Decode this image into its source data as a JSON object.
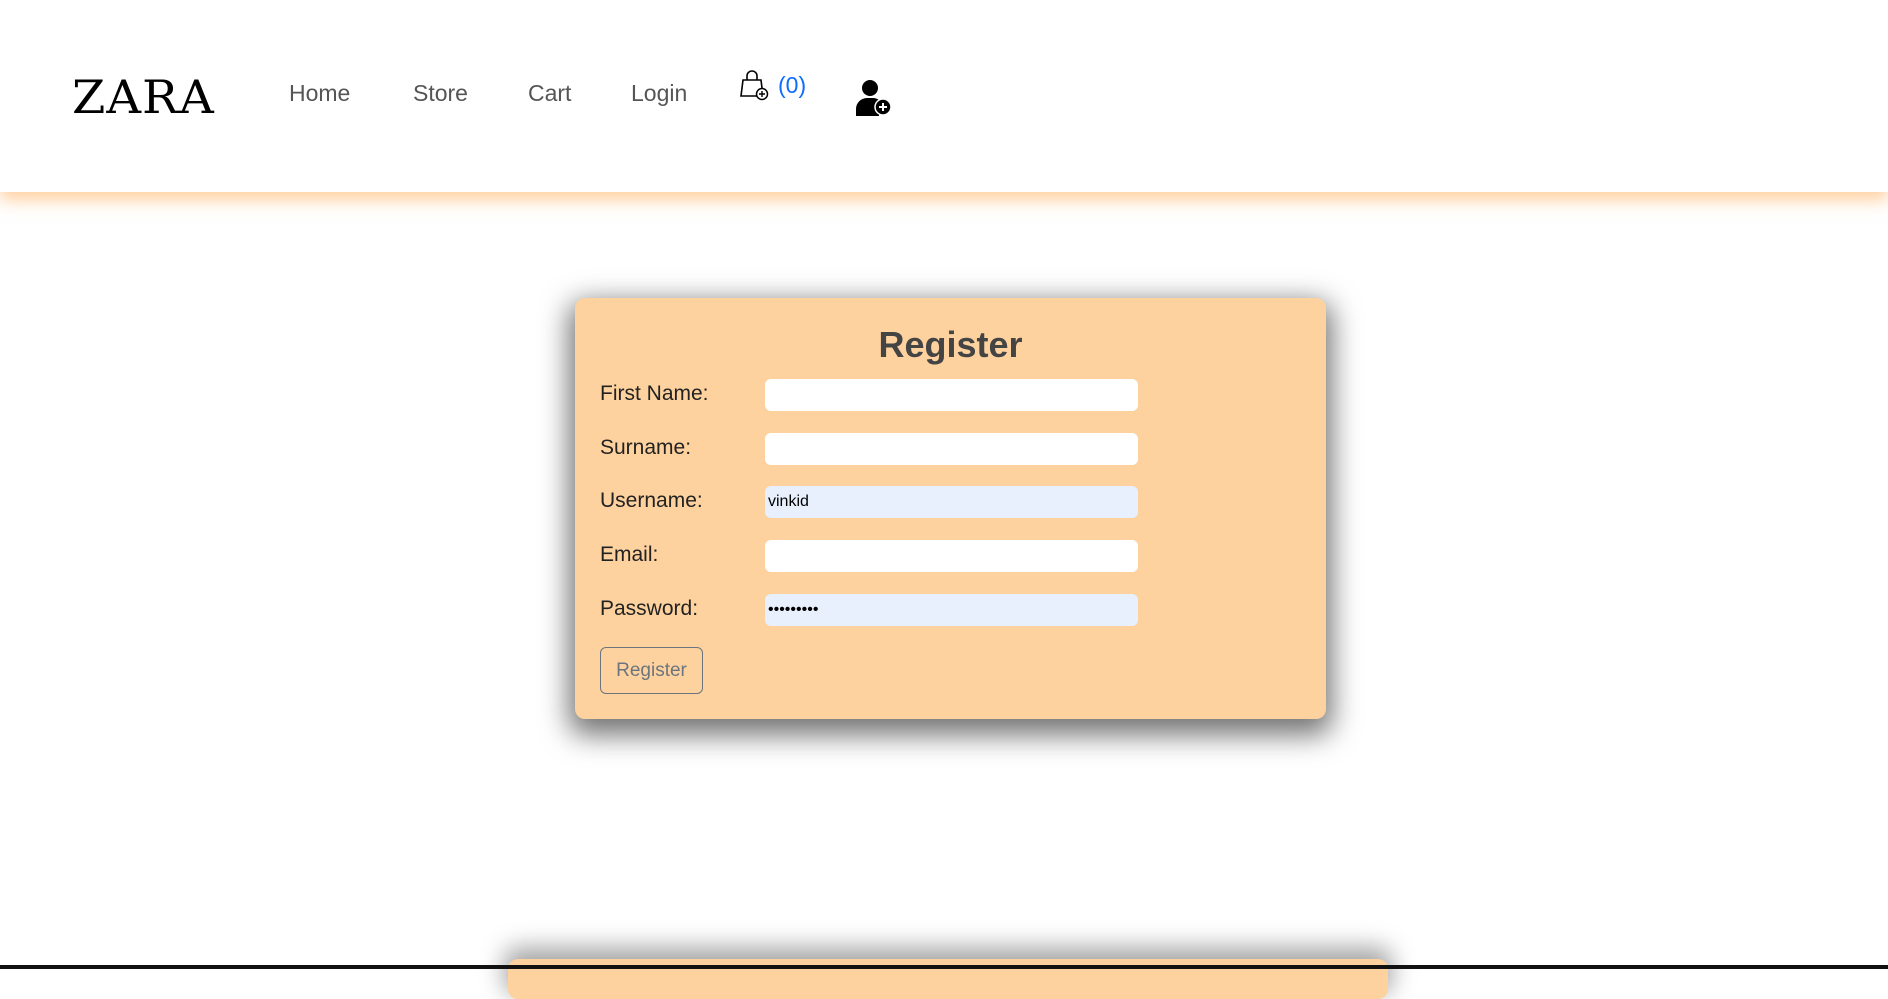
{
  "header": {
    "logo": "ZARA",
    "nav": [
      "Home",
      "Store",
      "Cart",
      "Login"
    ],
    "cart_count": "(0)",
    "cart_icon": "shopping-bag-plus-icon",
    "user_icon": "user-plus-icon"
  },
  "form": {
    "title": "Register",
    "fields": [
      {
        "label": "First Name:",
        "value": ""
      },
      {
        "label": "Surname:",
        "value": ""
      },
      {
        "label": "Username:",
        "value": "vinkid"
      },
      {
        "label": "Email:",
        "value": ""
      },
      {
        "label": "Password:",
        "value": "password1"
      }
    ],
    "submit_label": "Register"
  },
  "colors": {
    "card": "#fed29f",
    "accent": "#0d6efd"
  }
}
